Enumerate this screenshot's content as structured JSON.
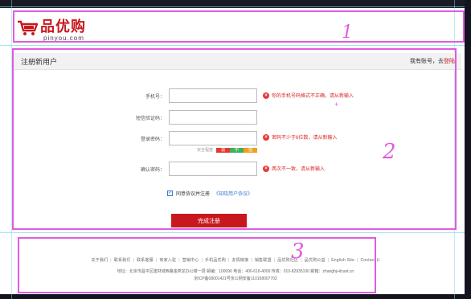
{
  "header": {
    "brand_cn": "品优购",
    "brand_en": "pinyou.com",
    "annotation": "1"
  },
  "register": {
    "title": "注册新用户",
    "have_account": "我有账号，去",
    "login_link": "登陆",
    "annotation": "2",
    "fields": [
      {
        "label": "手机号：",
        "value": "",
        "error": "你的手机号码格式不正确，请从新输入"
      },
      {
        "label": "短信验证码：",
        "value": "",
        "error": ""
      },
      {
        "label": "登录密码：",
        "value": "",
        "error": "密码不少于6位数，请从新输入"
      },
      {
        "label": "确认密码：",
        "value": "",
        "error": "两次不一致，请从新输入"
      }
    ],
    "strength": {
      "label": "安全程度",
      "levels": [
        "弱",
        "中",
        "强"
      ]
    },
    "agree_text": "同意协议并注册",
    "agreement_link": "《知晓用户协议》",
    "submit_label": "完成注册"
  },
  "footer": {
    "annotation": "3",
    "links": [
      "关于我们",
      "联系我们",
      "联系客服",
      "商家入驻",
      "营销中心",
      "手机品优购",
      "友情链接",
      "销售联盟",
      "品优购社区",
      "品优购公益",
      "English Site",
      "Contact U"
    ],
    "address": "地址：北京市昌平区建材城西路金燕龙办公楼一层 邮编：100096 电话：400-618-4000 传真：010-82935100 邮箱：zhanghj+itcast.cn",
    "icp": "京ICP备08001421号京公网安备110108007702"
  },
  "colors": {
    "brand": "#c8181e",
    "annotation": "#e05be0",
    "link": "#3a7bd5"
  }
}
